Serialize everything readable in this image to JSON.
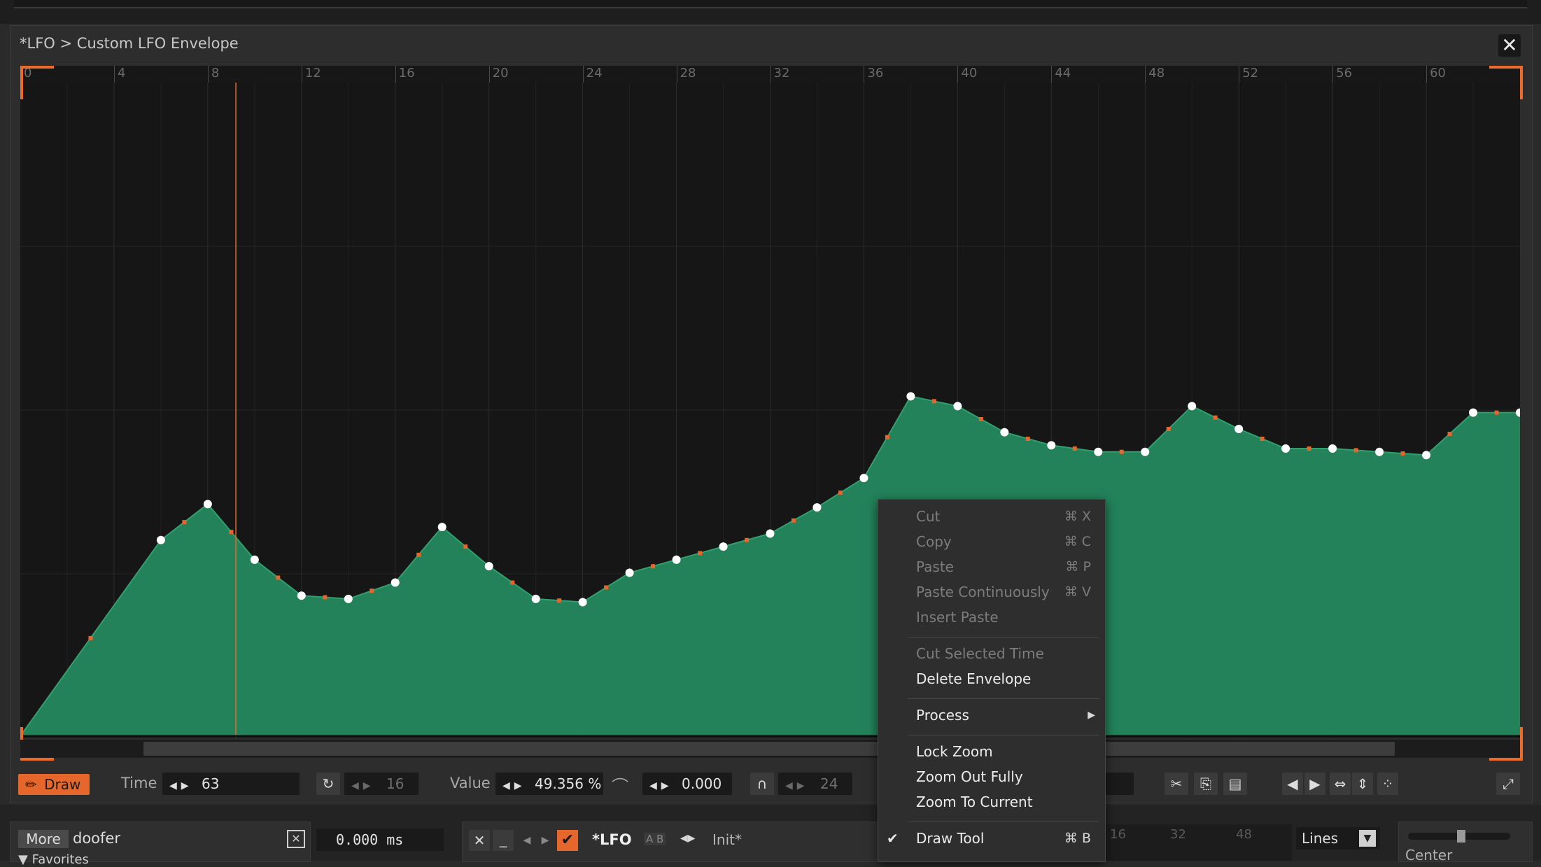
{
  "panel": {
    "title": "*LFO > Custom LFO Envelope",
    "close_symbol": "✕"
  },
  "ruler": {
    "ticks": [
      "0",
      "4",
      "8",
      "12",
      "16",
      "20",
      "24",
      "28",
      "32",
      "36",
      "40",
      "44",
      "48",
      "52",
      "56",
      "60"
    ]
  },
  "toolbar": {
    "draw_label": "Draw",
    "time_label": "Time",
    "time_value": "63",
    "grid_value": "16",
    "value_label": "Value",
    "value_value": "49.356 %",
    "curve_value": "0.000",
    "step_value": "24"
  },
  "bottom": {
    "more_label": "More",
    "device_name": "doofer",
    "delay_value": "0.000 ms",
    "lfo_name": "*LFO",
    "ab_labels": "A B",
    "preset_name": "Init*",
    "mini_ruler": [
      "16",
      "32",
      "48"
    ],
    "mode_value": "Lines",
    "center_label": "Center",
    "favorites_label": "Favorites"
  },
  "context_menu": {
    "items": [
      {
        "label": "Cut",
        "shortcut": "⌘ X",
        "enabled": false
      },
      {
        "label": "Copy",
        "shortcut": "⌘ C",
        "enabled": false
      },
      {
        "label": "Paste",
        "shortcut": "⌘ P",
        "enabled": false
      },
      {
        "label": "Paste Continuously",
        "shortcut": "⌘ V",
        "enabled": false
      },
      {
        "label": "Insert Paste",
        "shortcut": "",
        "enabled": false
      },
      {
        "label": "Cut Selected Time",
        "shortcut": "",
        "enabled": false
      },
      {
        "label": "Delete Envelope",
        "shortcut": "",
        "enabled": true
      },
      {
        "label": "Process",
        "shortcut": "",
        "enabled": true,
        "submenu": true
      },
      {
        "label": "Lock Zoom",
        "shortcut": "",
        "enabled": true
      },
      {
        "label": "Zoom Out Fully",
        "shortcut": "",
        "enabled": true
      },
      {
        "label": "Zoom To Current",
        "shortcut": "",
        "enabled": true
      },
      {
        "label": "Draw Tool",
        "shortcut": "⌘ B",
        "enabled": true,
        "checked": true
      }
    ]
  },
  "envelope": {
    "value_range": [
      0,
      1
    ],
    "time_range": [
      0,
      64
    ],
    "playhead_time": 9.2,
    "points": [
      [
        0,
        0
      ],
      [
        6,
        0.3
      ],
      [
        8,
        0.355
      ],
      [
        10,
        0.27
      ],
      [
        12,
        0.215
      ],
      [
        14,
        0.21
      ],
      [
        16,
        0.235
      ],
      [
        18,
        0.32
      ],
      [
        20,
        0.26
      ],
      [
        22,
        0.21
      ],
      [
        24,
        0.205
      ],
      [
        26,
        0.25
      ],
      [
        28,
        0.27
      ],
      [
        30,
        0.29
      ],
      [
        32,
        0.31
      ],
      [
        34,
        0.35
      ],
      [
        36,
        0.395
      ],
      [
        38,
        0.52
      ],
      [
        40,
        0.505
      ],
      [
        42,
        0.465
      ],
      [
        44,
        0.445
      ],
      [
        46,
        0.435
      ],
      [
        48,
        0.435
      ],
      [
        50,
        0.505
      ],
      [
        52,
        0.47
      ],
      [
        54,
        0.44
      ],
      [
        56,
        0.44
      ],
      [
        58,
        0.435
      ],
      [
        60,
        0.43
      ],
      [
        62,
        0.495
      ],
      [
        64,
        0.495
      ]
    ]
  },
  "colors": {
    "accent": "#e6672c",
    "envelope_fill": "#23825a",
    "envelope_line": "#2fa06e",
    "point": "#ffffff"
  }
}
